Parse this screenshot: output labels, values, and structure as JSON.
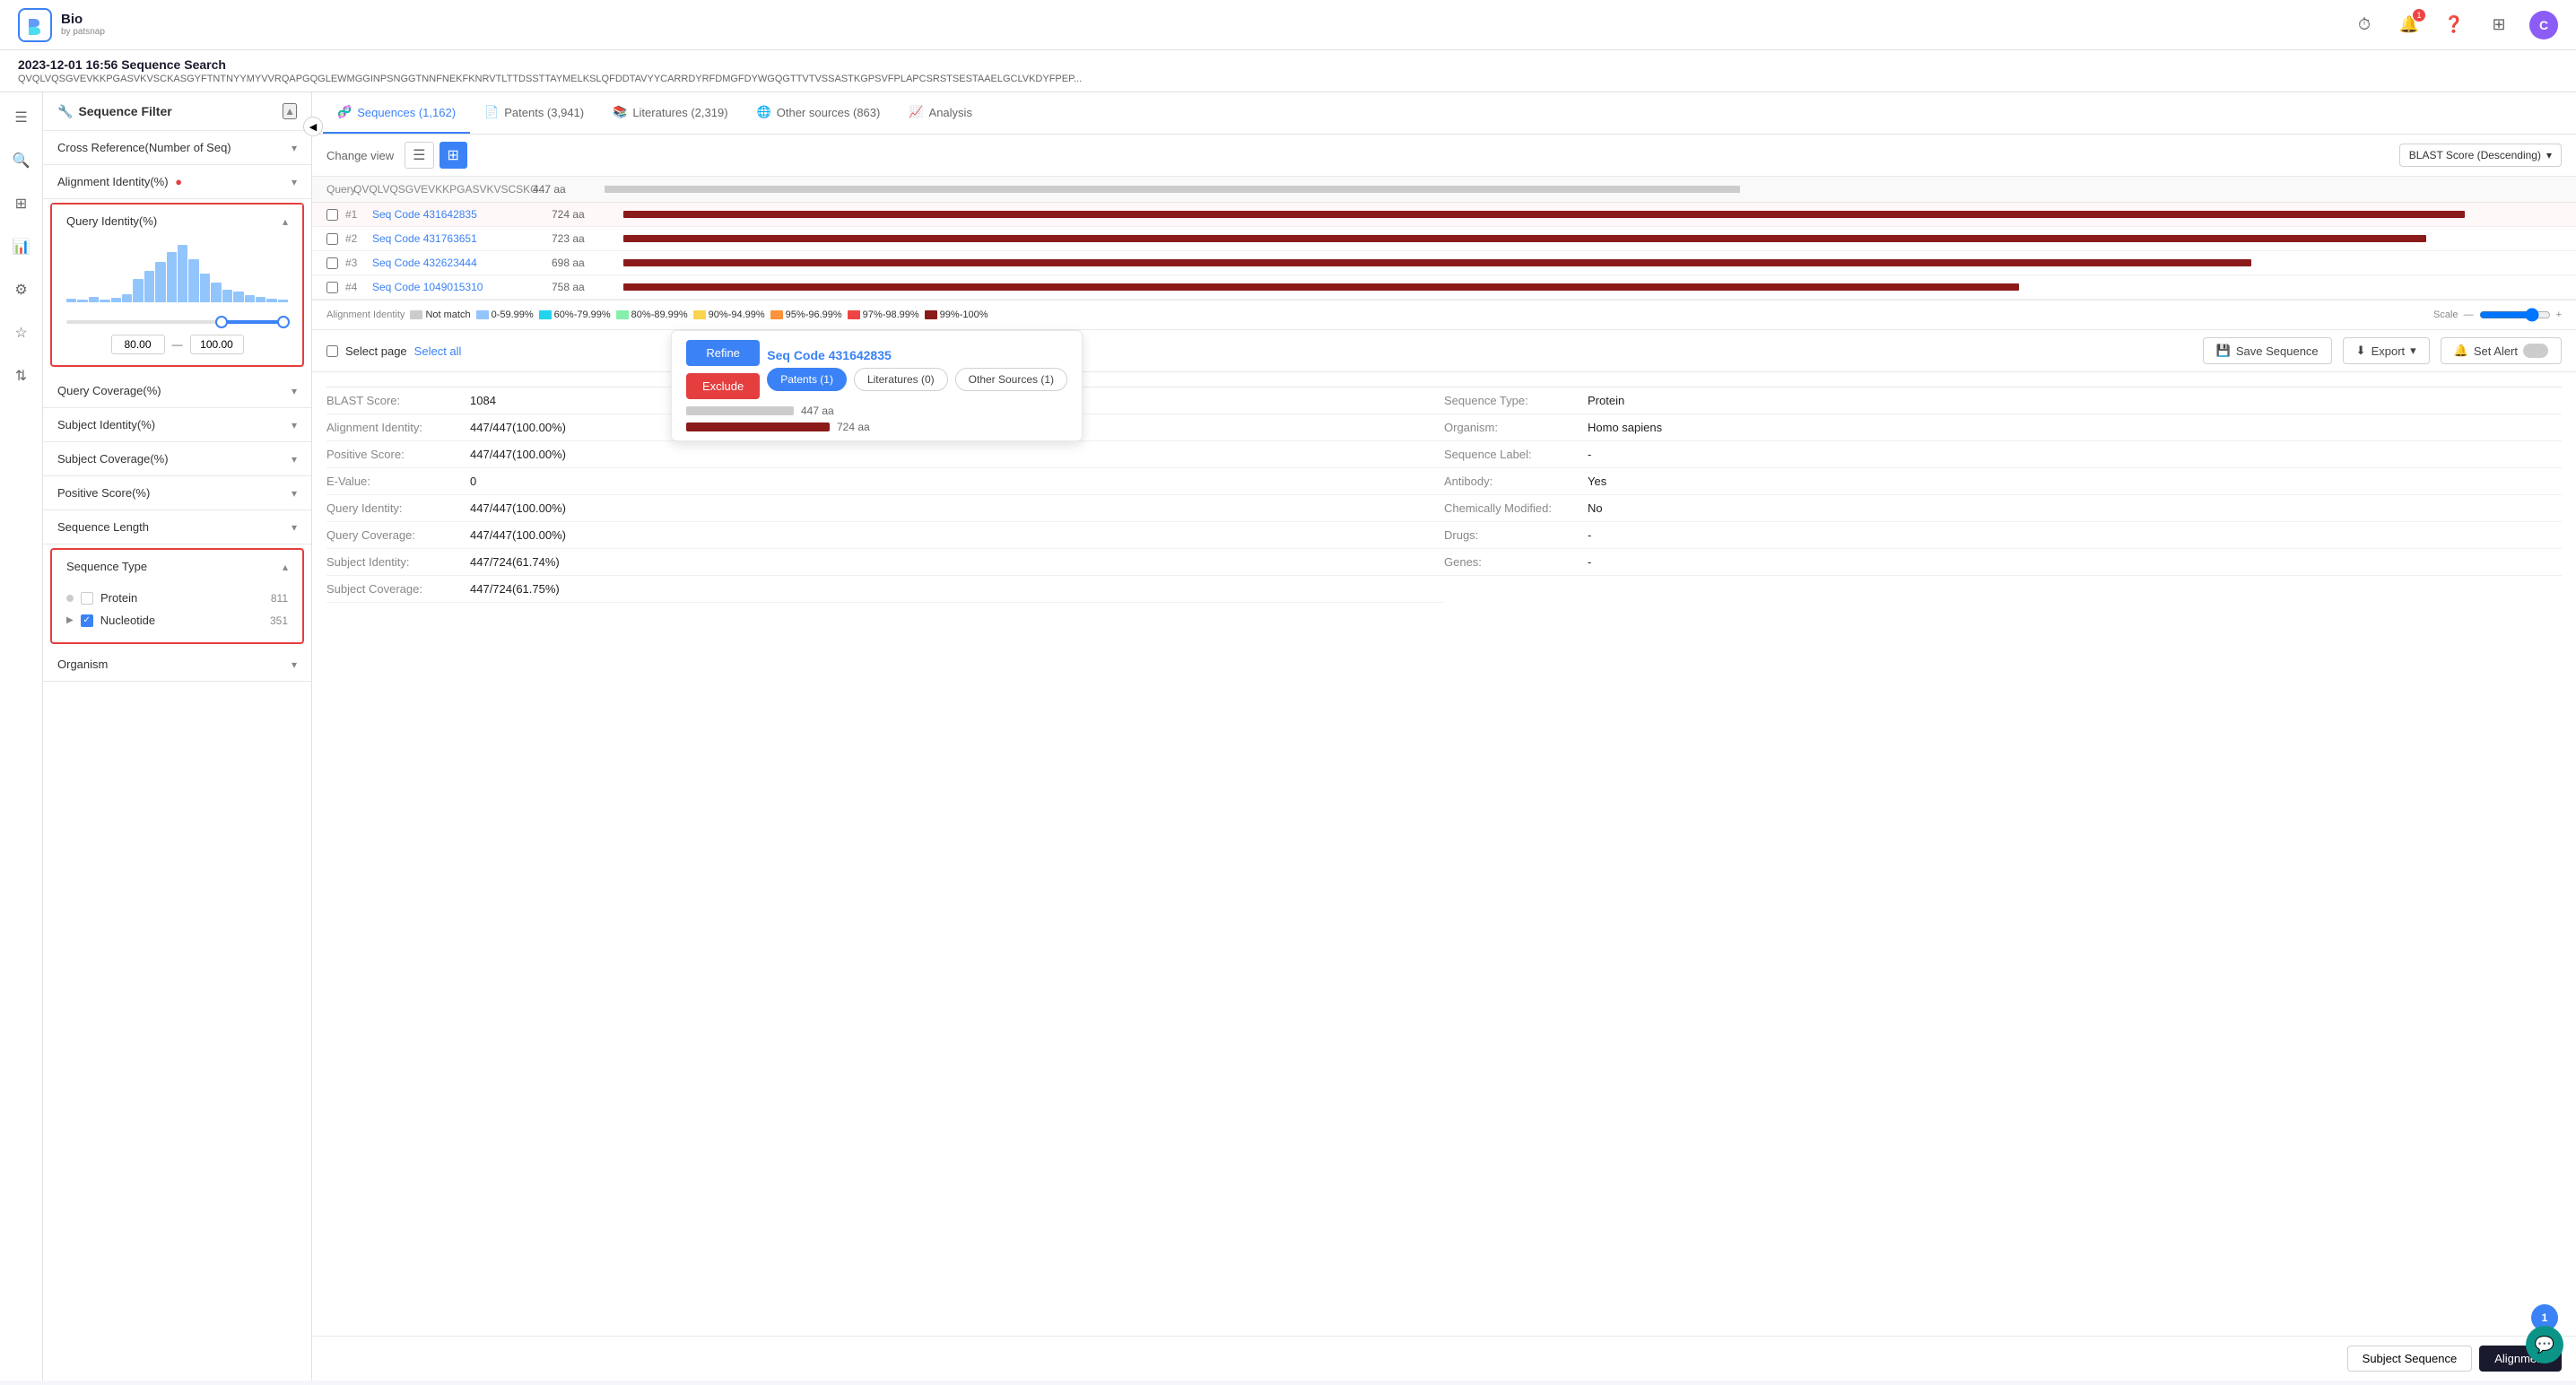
{
  "app": {
    "logo_text": "Bio",
    "logo_sub": "by patsnap",
    "logo_initial": "B"
  },
  "nav": {
    "icons": [
      "clock",
      "bell",
      "question",
      "grid",
      "user"
    ],
    "user_initial": "C",
    "notification_count": "1"
  },
  "breadcrumb": {
    "title": "2023-12-01 16:56 Sequence Search",
    "query": "QVQLVQSGVEVKKPGASVKVSCKASGYFTNTNYYMYVVRQAPGQGLEWMGGINPSNGGTNNFNEKFKNRVTLTTDSSTTAYMELKSLQFDDTAVYYCARRDYRFDMGFDYWGQGTTVTVSSASTKGPSVFPLAPCSRSTSESTAAELGCLVKDYFPEP..."
  },
  "filter": {
    "title": "Sequence Filter",
    "sections": [
      {
        "id": "cross_ref",
        "label": "Cross Reference(Number of Seq)",
        "expanded": false
      },
      {
        "id": "align_id",
        "label": "Alignment Identity(%)",
        "expanded": false
      },
      {
        "id": "query_id",
        "label": "Query Identity(%)",
        "expanded": true
      },
      {
        "id": "query_cov",
        "label": "Query Coverage(%)",
        "expanded": false
      },
      {
        "id": "subj_id",
        "label": "Subject Identity(%)",
        "expanded": false
      },
      {
        "id": "subj_cov",
        "label": "Subject Coverage(%)",
        "expanded": false
      },
      {
        "id": "pos_score",
        "label": "Positive Score(%)",
        "expanded": false
      },
      {
        "id": "seq_len",
        "label": "Sequence Length",
        "expanded": false
      },
      {
        "id": "seq_type",
        "label": "Sequence Type",
        "expanded": true
      },
      {
        "id": "organism",
        "label": "Organism",
        "expanded": false
      }
    ],
    "query_identity": {
      "min": "80.00",
      "max": "100.00",
      "chart_bars": [
        5,
        3,
        8,
        4,
        6,
        12,
        35,
        50,
        65,
        80,
        95,
        70,
        45,
        30,
        20,
        15,
        10,
        8,
        6,
        5
      ]
    },
    "seq_types": [
      {
        "label": "Protein",
        "count": "811",
        "checked": false
      },
      {
        "label": "Nucleotide",
        "count": "351",
        "checked": true,
        "expanded": true
      }
    ]
  },
  "tabs": [
    {
      "id": "sequences",
      "label": "Sequences (1,162)",
      "active": true,
      "icon": "dna"
    },
    {
      "id": "patents",
      "label": "Patents (3,941)",
      "active": false,
      "icon": "patent"
    },
    {
      "id": "literatures",
      "label": "Literatures (2,319)",
      "active": false,
      "icon": "book"
    },
    {
      "id": "other_sources",
      "label": "Other sources (863)",
      "active": false,
      "icon": "globe"
    },
    {
      "id": "analysis",
      "label": "Analysis",
      "active": false,
      "icon": "chart"
    }
  ],
  "toolbar": {
    "change_view": "Change view",
    "sort_label": "BLAST Score (Descending)"
  },
  "sequences": {
    "header": {
      "query_label": "Query",
      "query_seq": "QVQLVQSGVEVKKPGASVKVSCSKG...",
      "query_aa": "447 aa"
    },
    "rows": [
      {
        "num": "#1",
        "name": "Seq Code 431642835",
        "aa": "724 aa",
        "bar_width": "95%",
        "bar_color": "#8b1a1a"
      },
      {
        "num": "#2",
        "name": "Seq Code 431763651",
        "aa": "723 aa",
        "bar_width": "94%",
        "bar_color": "#8b1a1a"
      },
      {
        "num": "#3",
        "name": "Seq Code 432623444",
        "aa": "698 aa",
        "bar_width": "88%",
        "bar_color": "#8b1a1a"
      },
      {
        "num": "#4",
        "name": "Seq Code 1049015310",
        "aa": "758 aa",
        "bar_width": "76%",
        "bar_color": "#8b1a1a"
      }
    ]
  },
  "legend": {
    "items": [
      {
        "label": "Not match",
        "color": "#ccc"
      },
      {
        "label": "0-59.99%",
        "color": "#93c5fd"
      },
      {
        "label": "60%-79.99%",
        "color": "#22d3ee"
      },
      {
        "label": "80%-89.99%",
        "color": "#86efac"
      },
      {
        "label": "90%-94.99%",
        "color": "#fcd34d"
      },
      {
        "label": "95%-96.99%",
        "color": "#fb923c"
      },
      {
        "label": "97%-98.99%",
        "color": "#ef4444"
      },
      {
        "label": "99%-100%",
        "color": "#8b1a1a"
      }
    ],
    "alignment_label": "Alignment Identity",
    "scale_label": "Scale"
  },
  "select_row": {
    "select_page": "Select page",
    "select_all": "Select all",
    "save_sequence": "Save Sequence",
    "export": "Export",
    "set_alert": "Set Alert"
  },
  "refine_popup": {
    "seq_code": "Seq Code 431642835",
    "refine_label": "Refine",
    "exclude_label": "Exclude",
    "tab_patents": "Patents (1)",
    "tab_literatures": "Literatures (0)",
    "tab_other_sources": "Other Sources (1)"
  },
  "detail": {
    "blast_score_label": "BLAST Score:",
    "blast_score": "1084",
    "align_id_label": "Alignment Identity:",
    "align_id": "447/447(100.00%)",
    "pos_score_label": "Positive Score:",
    "pos_score": "447/447(100.00%)",
    "evalue_label": "E-Value:",
    "evalue": "0",
    "query_id_label": "Query Identity:",
    "query_id": "447/447(100.00%)",
    "query_cov_label": "Query Coverage:",
    "query_cov": "447/447(100.00%)",
    "subj_id_label": "Subject Identity:",
    "subj_id": "447/724(61.74%)",
    "subj_cov_label": "Subject Coverage:",
    "subj_cov": "447/724(61.75%)",
    "seq_type_label": "Sequence Type:",
    "seq_type": "Protein",
    "organism_label": "Organism:",
    "organism": "Homo sapiens",
    "seq_label_label": "Sequence Label:",
    "seq_label": "-",
    "antibody_label": "Antibody:",
    "antibody": "Yes",
    "chem_mod_label": "Chemically Modified:",
    "chem_mod": "No",
    "drugs_label": "Drugs:",
    "drugs": "-",
    "genes_label": "Genes:",
    "genes": "-"
  },
  "bottom_btns": {
    "subject_seq": "Subject Sequence",
    "alignment": "Alignment"
  },
  "colors": {
    "primary": "#3b82f6",
    "danger": "#e53e3e",
    "dark": "#1a1a2e"
  }
}
